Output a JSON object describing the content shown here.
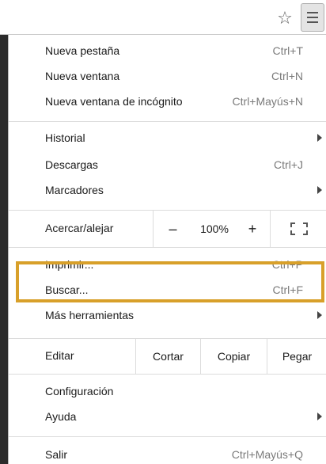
{
  "toolbar": {
    "star_glyph": "☆",
    "star_icon": "star-icon",
    "menu_icon": "hamburger-menu-icon"
  },
  "menu": {
    "new_tab": {
      "label": "Nueva pestaña",
      "shortcut": "Ctrl+T"
    },
    "new_window": {
      "label": "Nueva ventana",
      "shortcut": "Ctrl+N"
    },
    "incognito": {
      "label": "Nueva ventana de incógnito",
      "shortcut": "Ctrl+Mayús+N"
    },
    "history": {
      "label": "Historial"
    },
    "downloads": {
      "label": "Descargas",
      "shortcut": "Ctrl+J"
    },
    "bookmarks": {
      "label": "Marcadores"
    },
    "zoom": {
      "label": "Acercar/alejar",
      "minus": "–",
      "value": "100%",
      "plus": "+"
    },
    "print": {
      "label": "Imprimir...",
      "shortcut": "Ctrl+P"
    },
    "find": {
      "label": "Buscar...",
      "shortcut": "Ctrl+F"
    },
    "more_tools": {
      "label": "Más herramientas"
    },
    "edit": {
      "label": "Editar",
      "cut": "Cortar",
      "copy": "Copiar",
      "paste": "Pegar"
    },
    "settings": {
      "label": "Configuración"
    },
    "help": {
      "label": "Ayuda"
    },
    "exit": {
      "label": "Salir",
      "shortcut": "Ctrl+Mayús+Q"
    }
  },
  "colors": {
    "highlight": "#d8a02a",
    "background": "#2b2b2b"
  }
}
